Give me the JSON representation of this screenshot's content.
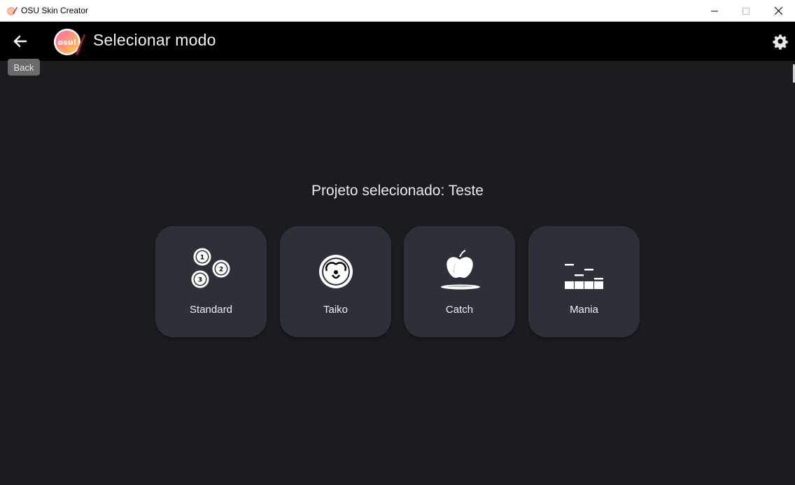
{
  "window": {
    "title": "OSU Skin Creator",
    "minimize_icon": "minimize-icon",
    "maximize_icon": "maximize-icon",
    "close_icon": "close-icon"
  },
  "appbar": {
    "back_icon": "arrow-left-icon",
    "logo": "osu!",
    "title": "Selecionar modo",
    "settings_icon": "gear-icon",
    "background": "#000000"
  },
  "tooltip": {
    "text": "Back"
  },
  "main": {
    "project_label": "Projeto selecionado: Teste",
    "modes": [
      {
        "label": "Standard",
        "icon": "circles-numbered-icon"
      },
      {
        "label": "Taiko",
        "icon": "taiko-drum-face-icon"
      },
      {
        "label": "Catch",
        "icon": "apple-on-plate-icon"
      },
      {
        "label": "Mania",
        "icon": "mania-notes-columns-icon"
      }
    ]
  },
  "colors": {
    "background": "#1b1c1f",
    "card": "#2c3039",
    "text": "#f0f0f0",
    "logo_gradient_start": "#ff66aa",
    "logo_gradient_end": "#ffcc44"
  }
}
